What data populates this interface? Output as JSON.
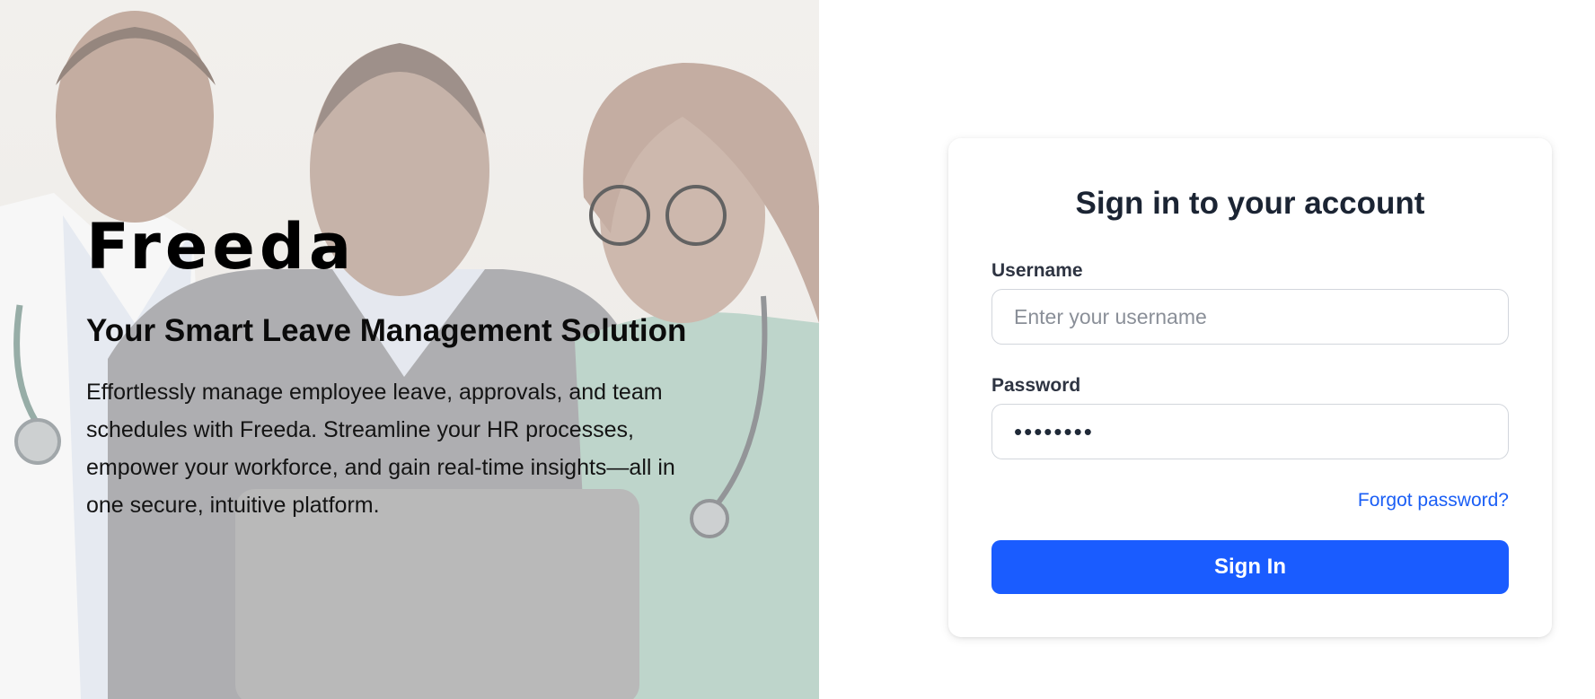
{
  "hero": {
    "image_alt": "Three smiling healthcare and business professionals looking at a laptop",
    "brand": "Freeda",
    "tagline": "Your Smart Leave Management Solution",
    "description": "Effortlessly manage employee leave, approvals, and team schedules with Freeda. Streamline your HR processes, empower your workforce, and gain real-time insights—all in one secure, intuitive platform."
  },
  "login": {
    "title": "Sign in to your account",
    "username": {
      "label": "Username",
      "placeholder": "Enter your username",
      "value": ""
    },
    "password": {
      "label": "Password",
      "value": "12345678"
    },
    "forgot_password": "Forgot password?",
    "submit_label": "Sign In"
  },
  "colors": {
    "primary": "#1a5cff",
    "link": "#1a5ef5",
    "heading": "#1b2433"
  }
}
